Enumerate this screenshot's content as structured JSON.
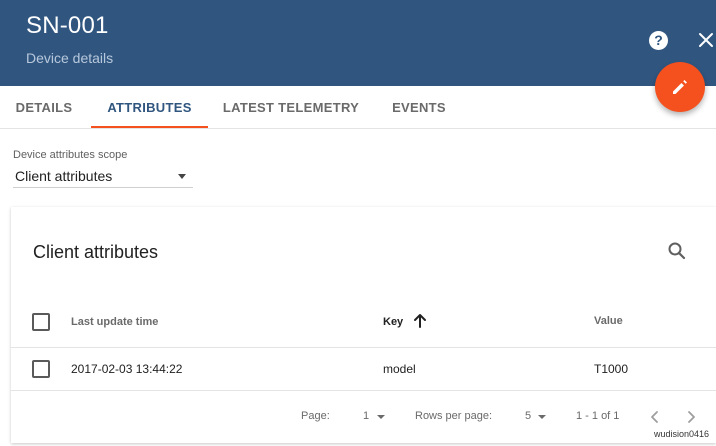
{
  "header": {
    "title": "SN-001",
    "subtitle": "Device details",
    "background": "#305680",
    "accent": "#f4511e",
    "icons": {
      "help": "help-circle-icon",
      "close": "close-icon",
      "fab": "pencil-icon"
    }
  },
  "tabs": [
    {
      "label": "DETAILS",
      "active": false
    },
    {
      "label": "ATTRIBUTES",
      "active": true
    },
    {
      "label": "LATEST TELEMETRY",
      "active": false
    },
    {
      "label": "EVENTS",
      "active": false
    }
  ],
  "scope": {
    "label": "Device attributes scope",
    "value": "Client attributes"
  },
  "card": {
    "title": "Client attributes",
    "columns": {
      "time": "Last update time",
      "key": "Key",
      "value": "Value",
      "sorted_by": "Key",
      "sort_direction": "ascending"
    },
    "rows": [
      {
        "time": "2017-02-03 13:44:22",
        "key": "model",
        "value": "T1000"
      }
    ],
    "pager": {
      "page_label": "Page:",
      "page_value": "1",
      "rows_label": "Rows per page:",
      "rows_value": "5",
      "range": "1 - 1 of 1"
    }
  },
  "watermark": "wudision0416"
}
